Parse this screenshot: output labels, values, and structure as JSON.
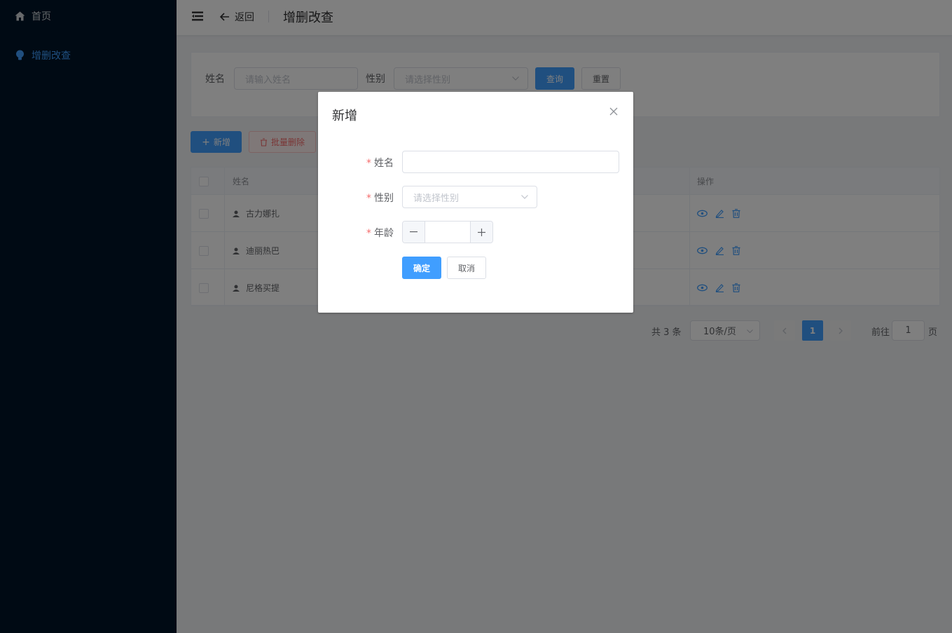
{
  "sidebar": {
    "items": [
      {
        "label": "首页",
        "icon": "home-icon"
      },
      {
        "label": "增删改查",
        "icon": "lightbulb-icon",
        "active": true
      }
    ]
  },
  "header": {
    "back_label": "返回",
    "title": "增删改查"
  },
  "search": {
    "name_label": "姓名",
    "name_placeholder": "请输入姓名",
    "gender_label": "性别",
    "gender_placeholder": "请选择性别",
    "query_label": "查询",
    "reset_label": "重置"
  },
  "toolbar": {
    "add_label": "新增",
    "batch_delete_label": "批量删除"
  },
  "table": {
    "columns": {
      "name": "姓名",
      "ops": "操作"
    },
    "rows": [
      {
        "name": "古力娜扎"
      },
      {
        "name": "迪丽热巴"
      },
      {
        "name": "尼格买提"
      }
    ]
  },
  "pagination": {
    "total_text": "共 3 条",
    "page_size": "10条/页",
    "current_page": "1",
    "goto_prefix": "前往",
    "goto_value": "1",
    "goto_suffix": "页"
  },
  "dialog": {
    "title": "新增",
    "name_label": "姓名",
    "name_value": "",
    "gender_label": "性别",
    "gender_placeholder": "请选择性别",
    "age_label": "年龄",
    "age_value": "",
    "confirm_label": "确定",
    "cancel_label": "取消"
  },
  "colors": {
    "primary": "#409eff",
    "sidebar_bg": "#001529",
    "required": "#f56c6c"
  }
}
